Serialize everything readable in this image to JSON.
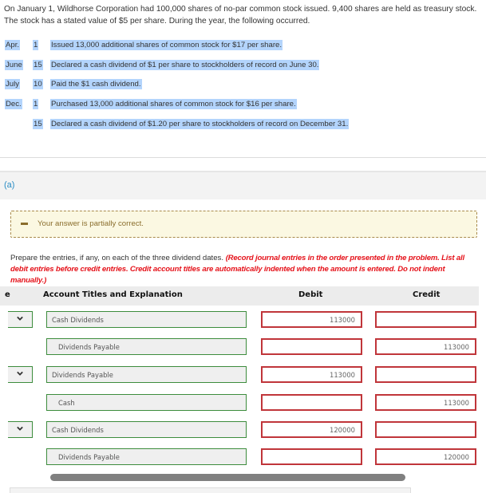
{
  "problem": {
    "intro": "On January 1, Wildhorse Corporation had 100,000 shares of no-par common stock issued. 9,400 shares are held as treasury stock. The stock has a stated value of $5 per share. During the year, the following occurred.",
    "events": [
      {
        "month": "Apr.",
        "day": "1",
        "text": "Issued 13,000 additional shares of common stock for $17 per share."
      },
      {
        "month": "June",
        "day": "15",
        "text": "Declared a cash dividend of $1 per share to stockholders of record on June 30."
      },
      {
        "month": "July",
        "day": "10",
        "text": "Paid the $1 cash dividend."
      },
      {
        "month": "Dec.",
        "day": "1",
        "text": "Purchased 13,000 additional shares of common stock for $16 per share."
      },
      {
        "month": "",
        "day": "15",
        "text": "Declared a cash dividend of $1.20 per share to stockholders of record on December 31."
      }
    ]
  },
  "part": {
    "label": "(a)"
  },
  "feedback": {
    "icon": "minus-icon",
    "text": "Your answer is partially correct.",
    "color": "#8a6d2c"
  },
  "instructions": {
    "main": "Prepare the entries, if any, on each of the three dividend dates. ",
    "note": "(Record journal entries in the order presented in the problem. List all debit entries before credit entries. Credit account titles are automatically indented when the amount is entered. Do not indent manually.)"
  },
  "table": {
    "headers": {
      "date": "e",
      "account": "Account Titles and Explanation",
      "debit": "Debit",
      "credit": "Credit"
    },
    "rows": [
      {
        "has_date_select": true,
        "account": "Cash Dividends",
        "debit": "113000",
        "credit": ""
      },
      {
        "has_date_select": false,
        "account": "Dividends Payable",
        "debit": "",
        "credit": "113000"
      },
      {
        "has_date_select": true,
        "account": "Dividends Payable",
        "debit": "113000",
        "credit": ""
      },
      {
        "has_date_select": false,
        "account": "Cash",
        "debit": "",
        "credit": "113000"
      },
      {
        "has_date_select": true,
        "account": "Cash Dividends",
        "debit": "120000",
        "credit": ""
      },
      {
        "has_date_select": false,
        "account": "Dividends Payable",
        "debit": "",
        "credit": "120000"
      }
    ]
  },
  "colors": {
    "part_label": "#2a8dc4",
    "instruction_red": "#e5121a",
    "account_border_correct": "#3c8c3c",
    "amount_border_incorrect": "#c0353a",
    "highlight": "#b3d4fc"
  }
}
